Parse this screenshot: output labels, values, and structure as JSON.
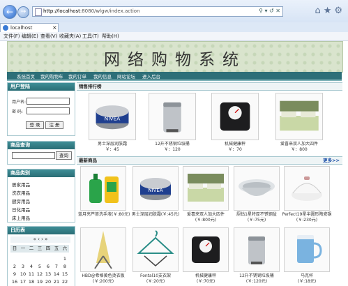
{
  "browser": {
    "url_host": "http://localhost",
    "url_rest": ":8080/wlgw/index.action",
    "tab_title": "localhost",
    "menu": [
      "文件(F)",
      "编辑(E)",
      "查看(V)",
      "收藏夹(A)",
      "工具(T)",
      "帮助(H)"
    ]
  },
  "site": {
    "title": "网络购物系统",
    "nav": [
      "系统首页",
      "我的购物车",
      "我的订单",
      "我的信息",
      "网站论坛",
      "进入后台"
    ]
  },
  "login": {
    "header": "用户登陆",
    "username_label": "用户名:",
    "password_label": "密 码:",
    "login_btn": "登 录",
    "register_btn": "注 册"
  },
  "search": {
    "header": "商品查询",
    "button": "查询"
  },
  "categories": {
    "header": "商品类别",
    "items": [
      "居家用品",
      "洗衣用品",
      "厨房用品",
      "日化用品",
      "床上用品"
    ]
  },
  "calendar": {
    "header": "日历表",
    "weekdays": [
      "日",
      "一",
      "二",
      "三",
      "四",
      "五",
      "六"
    ],
    "days": [
      "",
      "",
      "",
      "",
      "",
      "",
      "1",
      "2",
      "3",
      "4",
      "5",
      "6",
      "7",
      "8",
      "9",
      "10",
      "11",
      "12",
      "13",
      "14",
      "15",
      "16",
      "17",
      "18",
      "19",
      "20",
      "21",
      "22"
    ]
  },
  "ranking": {
    "header": "销售排行榜",
    "items": [
      {
        "name": "男士深层润肤霜",
        "price": "￥：45",
        "img": "cream"
      },
      {
        "name": "12升不锈钢垃圾桶",
        "price": "￥：120",
        "img": "bin"
      },
      {
        "name": "机械健康秤",
        "price": "￥：70",
        "img": "scale"
      },
      {
        "name": "爱喜来双人加大四件",
        "price": "￥：800",
        "img": "bed"
      }
    ]
  },
  "newest": {
    "header": "最新商品",
    "more": "更多>>",
    "items": [
      {
        "name": "蓝月亮芦荟洗手液(￥:80元)",
        "img": "soap"
      },
      {
        "name": "男士深层润肤霜(￥:45元)",
        "img": "cream"
      },
      {
        "name": "爱喜来双人加大四件",
        "price": "(￥:800元)",
        "img": "bed"
      },
      {
        "name": "厨钻1星特厚不锈钢盆",
        "price": "(￥:75元)",
        "img": "bowl"
      },
      {
        "name": "Perfect19星半圆形陶瓷锅",
        "price": "(￥:230元)",
        "img": "pot"
      },
      {
        "name": "HBD@希格黄色烫衣板",
        "price": "(￥:200元)",
        "img": "board"
      },
      {
        "name": "Fontal10支衣架",
        "price": "(￥:20元)",
        "img": "hanger"
      },
      {
        "name": "机械健康秤",
        "price": "(￥:70元)",
        "img": "scale"
      },
      {
        "name": "12升不锈钢垃圾桶",
        "price": "(￥:120元)",
        "img": "bin"
      },
      {
        "name": "马克杯",
        "price": "(￥:18元)",
        "img": "cup"
      }
    ]
  }
}
